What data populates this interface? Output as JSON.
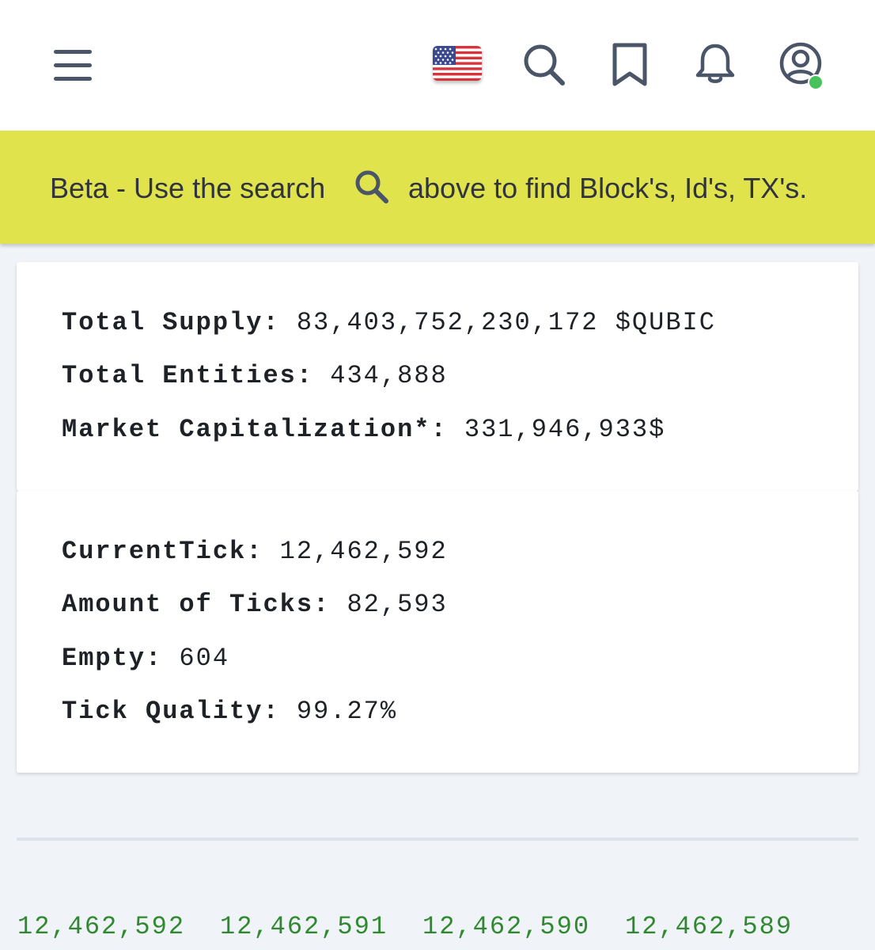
{
  "banner": {
    "text_before": "Beta - Use the search",
    "text_after": "above to find Block's, Id's, TX's."
  },
  "icons": {
    "menu": "hamburger-menu-icon",
    "flag": "us-flag-icon",
    "search": "search-icon",
    "bookmark": "bookmark-icon",
    "notifications": "bell-icon",
    "user": "user-account-icon"
  },
  "colors": {
    "banner_bg": "#e0e34c",
    "tick_link": "#2f8a2f",
    "online_dot": "#48c35b",
    "page_bg": "#f0f3f8"
  },
  "supply_card": {
    "total_supply_label": "Total Supply:",
    "total_supply_value": "83,403,752,230,172 $QUBIC",
    "total_entities_label": "Total Entities:",
    "total_entities_value": "434,888",
    "market_cap_label": "Market Capitalization*:",
    "market_cap_value": "331,946,933$"
  },
  "tick_card": {
    "current_tick_label": "CurrentTick:",
    "current_tick_value": "12,462,592",
    "amount_ticks_label": "Amount of Ticks:",
    "amount_ticks_value": "82,593",
    "empty_label": "Empty:",
    "empty_value": "604",
    "tick_quality_label": "Tick Quality:",
    "tick_quality_value": "99.27%"
  },
  "recent_ticks": [
    "12,462,592",
    "12,462,591",
    "12,462,590",
    "12,462,589"
  ]
}
